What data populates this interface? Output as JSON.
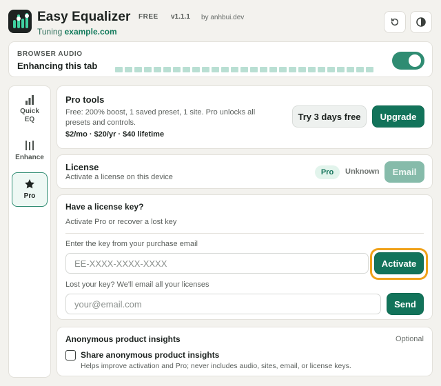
{
  "header": {
    "app_name": "Easy Equalizer",
    "plan_badge": "FREE",
    "version": "v1.1.1",
    "author": "by anhbui.dev",
    "tuning_prefix": "Tuning",
    "tuning_site": "example.com",
    "reset_icon": "reset-icon",
    "theme_icon": "contrast-icon"
  },
  "audio": {
    "label": "BROWSER AUDIO",
    "status": "Enhancing this tab",
    "enabled": true,
    "toggle_color": "#2f8c72"
  },
  "sidebar": {
    "items": [
      {
        "label": "Quick EQ",
        "icon": "bar-chart-icon",
        "active": false
      },
      {
        "label": "Enhance",
        "icon": "sliders-icon",
        "active": false
      },
      {
        "label": "Pro",
        "icon": "star-icon",
        "active": true
      }
    ]
  },
  "pro_tools": {
    "title": "Pro tools",
    "description": "Free: 200% boost, 1 saved preset, 1 site. Pro unlocks all presets and controls.",
    "pricing": "$2/mo · $20/yr · $40 lifetime",
    "trial_button": "Try 3 days free",
    "upgrade_button": "Upgrade"
  },
  "license": {
    "title": "License",
    "subtitle": "Activate a license on this device",
    "tier_badge": "Pro",
    "status": "Unknown",
    "email_button": "Email"
  },
  "license_key": {
    "title": "Have a license key?",
    "subtitle": "Activate Pro or recover a lost key",
    "key_label": "Enter the key from your purchase email",
    "key_placeholder": "EE-XXXX-XXXX-XXXX",
    "key_value": "",
    "activate_button": "Activate",
    "lost_label": "Lost your key? We'll email all your licenses",
    "email_placeholder": "your@email.com",
    "email_value": "",
    "send_button": "Send"
  },
  "insights": {
    "title": "Anonymous product insights",
    "optional": "Optional",
    "checkbox_label": "Share anonymous product insights",
    "checked": false,
    "help": "Helps improve activation and Pro; never includes audio, sites, email, or license keys."
  },
  "colors": {
    "accent": "#12735a",
    "accent_light": "#86bbaa",
    "focus": "#f0a21b",
    "background": "#f3f2ee"
  }
}
